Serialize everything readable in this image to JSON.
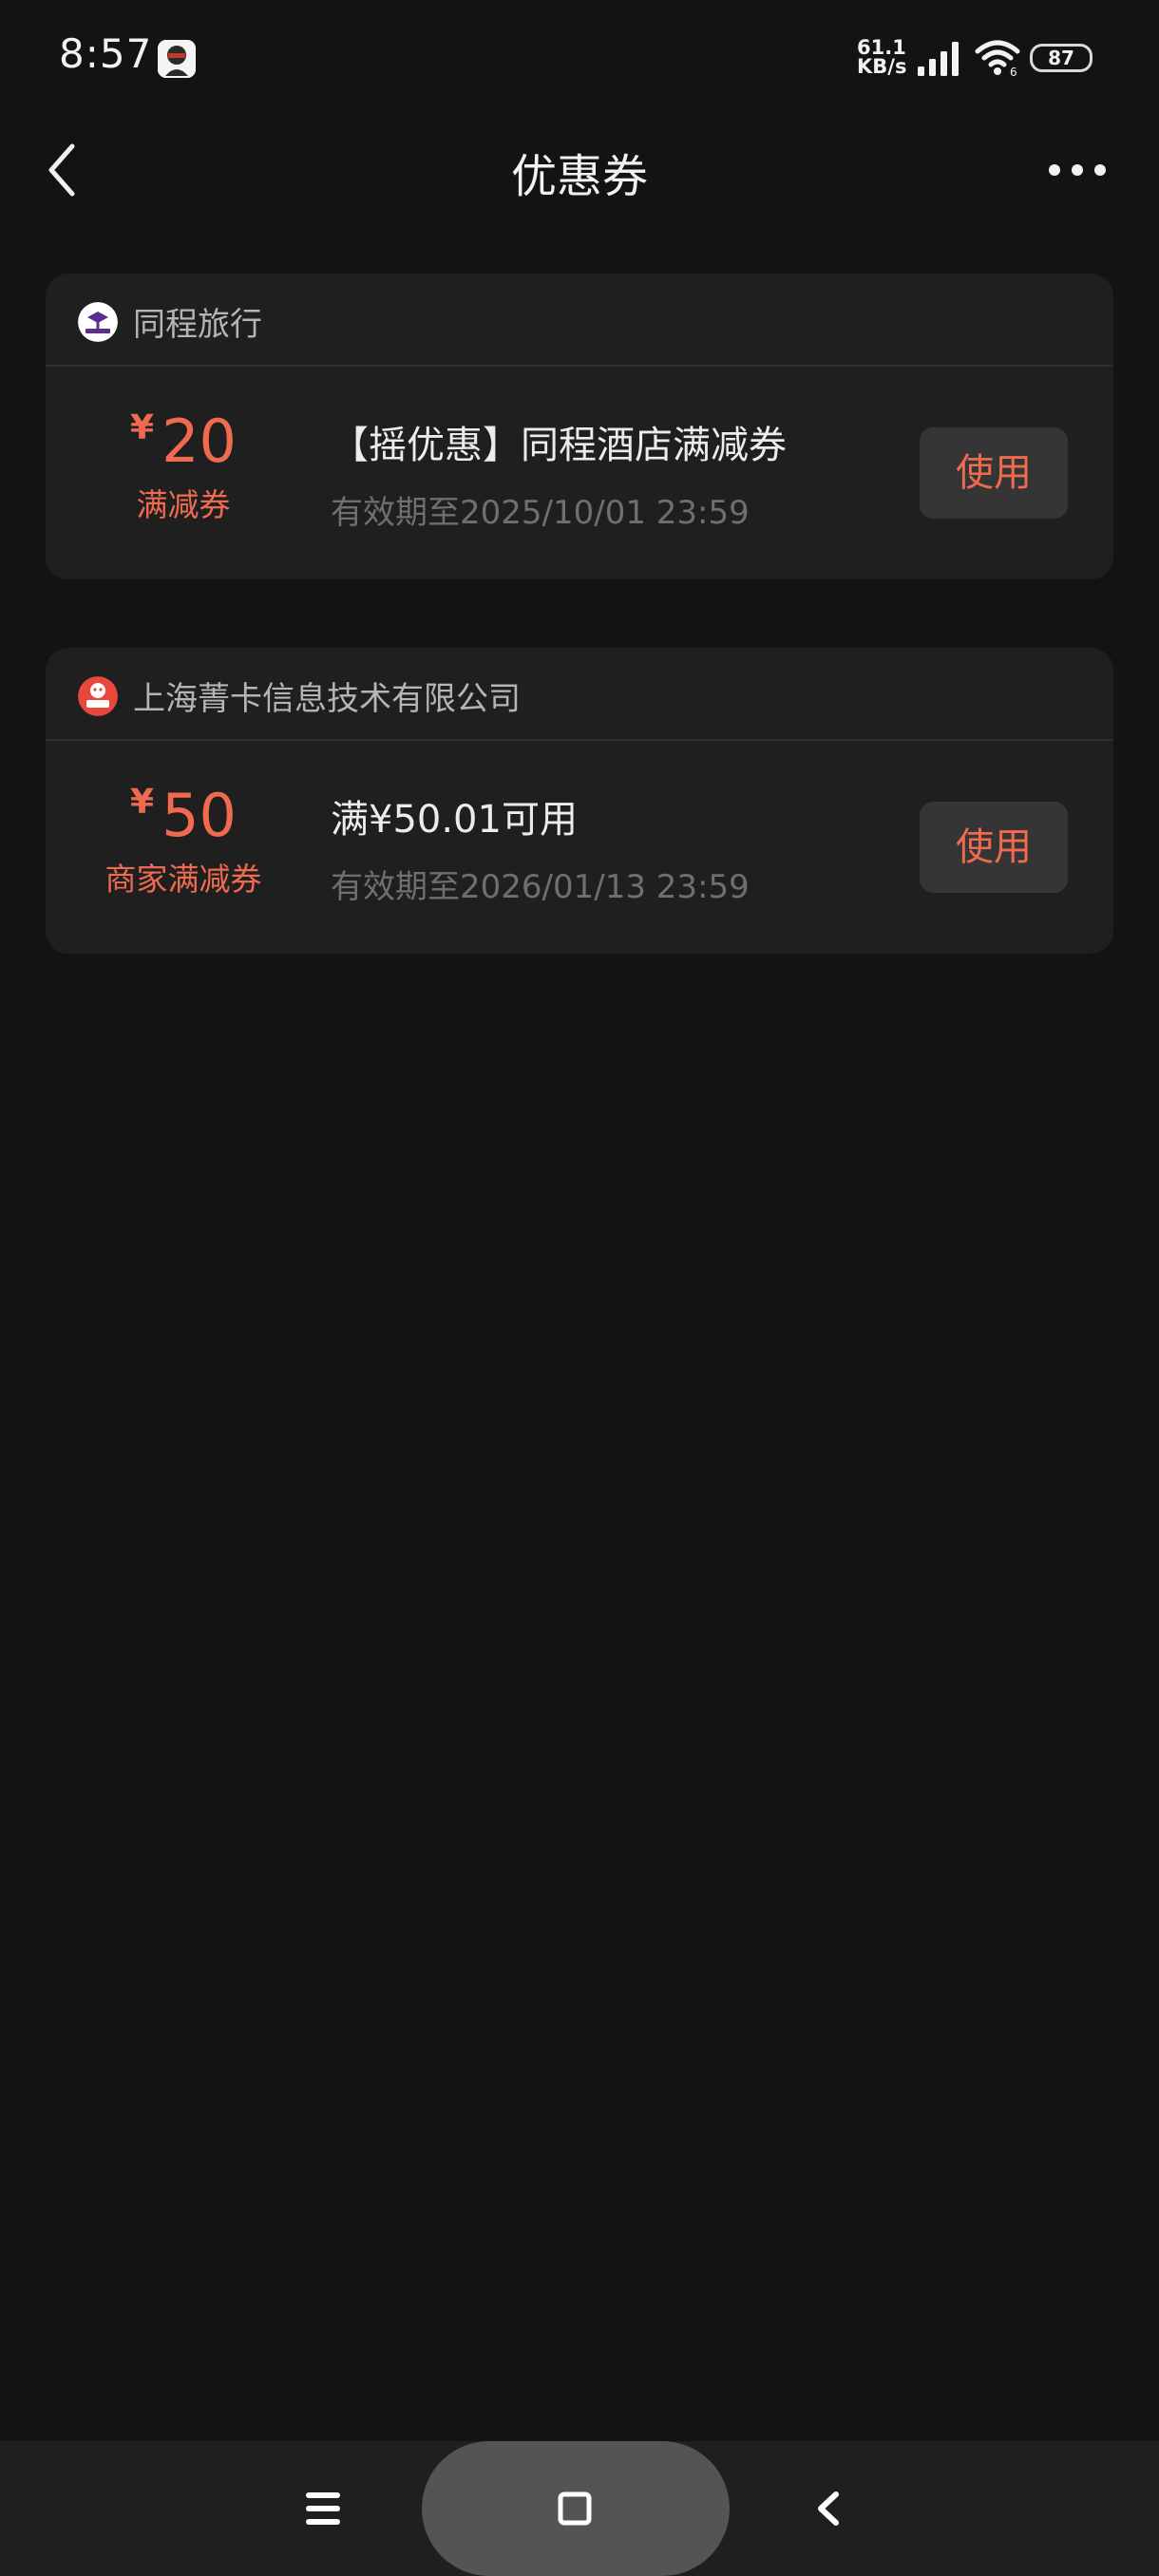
{
  "status_bar": {
    "time": "8:57",
    "net_speed_value": "61.1",
    "net_speed_unit": "KB/s",
    "battery": "87",
    "icons": [
      "avatar-icon",
      "signal-icon",
      "wifi-icon",
      "battery-icon"
    ]
  },
  "header": {
    "title": "优惠券",
    "icons": [
      "back-icon",
      "more-icon"
    ]
  },
  "coupons": [
    {
      "merchant": "同程旅行",
      "currency": "¥",
      "amount": "20",
      "type": "满减券",
      "title": "【摇优惠】同程酒店满减券",
      "expiry": "有效期至2025/10/01 23:59",
      "button": "使用"
    },
    {
      "merchant": "上海菁卡信息技术有限公司",
      "currency": "¥",
      "amount": "50",
      "type": "商家满减券",
      "title": "满¥50.01可用",
      "expiry": "有效期至2026/01/13 23:59",
      "button": "使用"
    }
  ],
  "nav": {
    "icons": [
      "menu-icon",
      "home-icon",
      "back-icon"
    ]
  },
  "colors": {
    "background": "#131313",
    "card": "#1f1f1f",
    "accent": "#ef6a4f",
    "button_bg": "#353535"
  }
}
